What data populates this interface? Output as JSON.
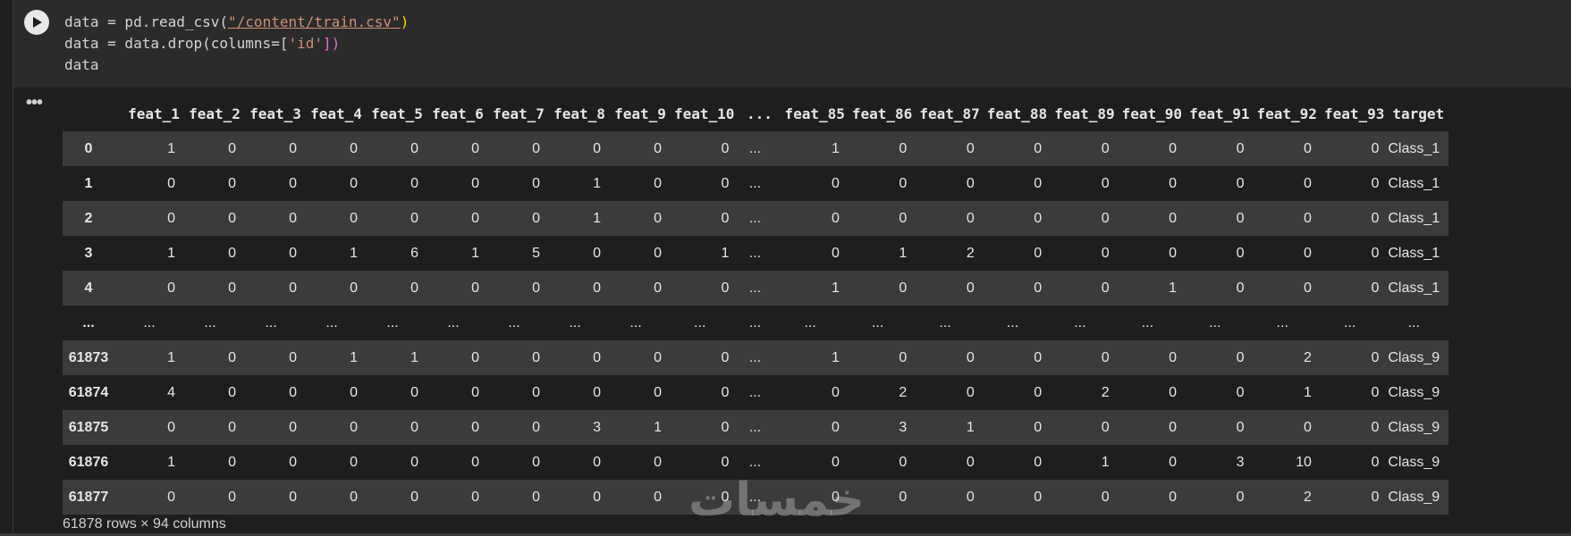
{
  "code": {
    "line1_pre": "data = pd.read_csv(",
    "line1_str": "\"/content/train.csv\"",
    "line1_post": ")",
    "line2_pre": "data = data.drop(columns=[",
    "line2_str": "'id'",
    "line2_post": "])",
    "line3": "data"
  },
  "output": {
    "more_label": "•••",
    "footer": "61878 rows × 94 columns"
  },
  "watermark": "خمسات",
  "table": {
    "columns": [
      "",
      "feat_1",
      "feat_2",
      "feat_3",
      "feat_4",
      "feat_5",
      "feat_6",
      "feat_7",
      "feat_8",
      "feat_9",
      "feat_10",
      "...",
      "feat_85",
      "feat_86",
      "feat_87",
      "feat_88",
      "feat_89",
      "feat_90",
      "feat_91",
      "feat_92",
      "feat_93",
      "target"
    ],
    "rows": [
      [
        "0",
        "1",
        "0",
        "0",
        "0",
        "0",
        "0",
        "0",
        "0",
        "0",
        "0",
        "...",
        "1",
        "0",
        "0",
        "0",
        "0",
        "0",
        "0",
        "0",
        "0",
        "Class_1"
      ],
      [
        "1",
        "0",
        "0",
        "0",
        "0",
        "0",
        "0",
        "0",
        "1",
        "0",
        "0",
        "...",
        "0",
        "0",
        "0",
        "0",
        "0",
        "0",
        "0",
        "0",
        "0",
        "Class_1"
      ],
      [
        "2",
        "0",
        "0",
        "0",
        "0",
        "0",
        "0",
        "0",
        "1",
        "0",
        "0",
        "...",
        "0",
        "0",
        "0",
        "0",
        "0",
        "0",
        "0",
        "0",
        "0",
        "Class_1"
      ],
      [
        "3",
        "1",
        "0",
        "0",
        "1",
        "6",
        "1",
        "5",
        "0",
        "0",
        "1",
        "...",
        "0",
        "1",
        "2",
        "0",
        "0",
        "0",
        "0",
        "0",
        "0",
        "Class_1"
      ],
      [
        "4",
        "0",
        "0",
        "0",
        "0",
        "0",
        "0",
        "0",
        "0",
        "0",
        "0",
        "...",
        "1",
        "0",
        "0",
        "0",
        "0",
        "1",
        "0",
        "0",
        "0",
        "Class_1"
      ],
      [
        "...",
        "...",
        "...",
        "...",
        "...",
        "...",
        "...",
        "...",
        "...",
        "...",
        "...",
        "...",
        "...",
        "...",
        "...",
        "...",
        "...",
        "...",
        "...",
        "...",
        "...",
        "..."
      ],
      [
        "61873",
        "1",
        "0",
        "0",
        "1",
        "1",
        "0",
        "0",
        "0",
        "0",
        "0",
        "...",
        "1",
        "0",
        "0",
        "0",
        "0",
        "0",
        "0",
        "2",
        "0",
        "Class_9"
      ],
      [
        "61874",
        "4",
        "0",
        "0",
        "0",
        "0",
        "0",
        "0",
        "0",
        "0",
        "0",
        "...",
        "0",
        "2",
        "0",
        "0",
        "2",
        "0",
        "0",
        "1",
        "0",
        "Class_9"
      ],
      [
        "61875",
        "0",
        "0",
        "0",
        "0",
        "0",
        "0",
        "0",
        "3",
        "1",
        "0",
        "...",
        "0",
        "3",
        "1",
        "0",
        "0",
        "0",
        "0",
        "0",
        "0",
        "Class_9"
      ],
      [
        "61876",
        "1",
        "0",
        "0",
        "0",
        "0",
        "0",
        "0",
        "0",
        "0",
        "0",
        "...",
        "0",
        "0",
        "0",
        "0",
        "1",
        "0",
        "3",
        "10",
        "0",
        "Class_9"
      ],
      [
        "61877",
        "0",
        "0",
        "0",
        "0",
        "0",
        "0",
        "0",
        "0",
        "0",
        "0",
        "...",
        "0",
        "0",
        "0",
        "0",
        "0",
        "0",
        "0",
        "2",
        "0",
        "Class_9"
      ]
    ]
  },
  "colors": {
    "background": "#1e1e1e",
    "code_bg": "#2b2b2b",
    "row_stripe": "#3b3b3b",
    "string": "#ce9178"
  },
  "icons": {
    "run": "play-icon",
    "more": "more-horizontal-icon"
  }
}
